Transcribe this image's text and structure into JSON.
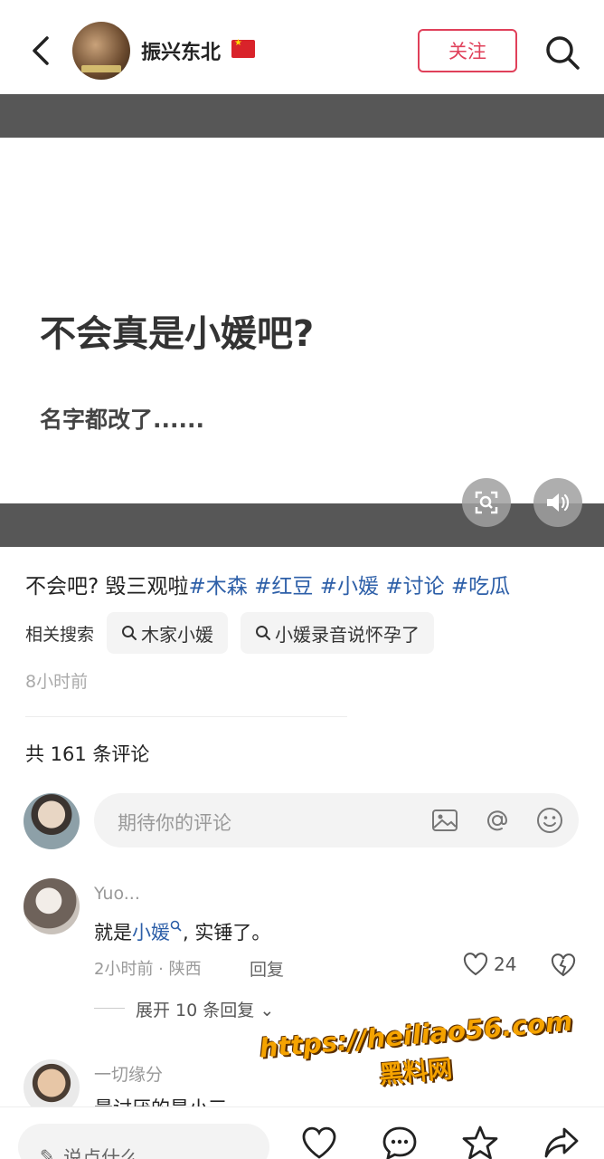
{
  "header": {
    "username": "振兴东北",
    "follow_label": "关注"
  },
  "post": {
    "title": "不会真是小媛吧?",
    "subtitle": "名字都改了......"
  },
  "caption": {
    "text": "不会吧?  毁三观啦",
    "tags": [
      "#木森",
      "#红豆",
      "#小媛",
      "#讨论",
      "#吃瓜"
    ]
  },
  "related": {
    "label": "相关搜索",
    "items": [
      "木家小媛",
      "小媛录音说怀孕了"
    ]
  },
  "time_ago": "8小时前",
  "comments": {
    "count_label": "共 161 条评论",
    "input_placeholder": "期待你的评论",
    "items": [
      {
        "user": "Yuo...",
        "text_before": "就是",
        "link": "小媛",
        "text_after": ", 实锤了。",
        "meta": "2小时前 · 陕西",
        "reply_label": "回复",
        "likes": "24",
        "expand_label": "展开 10 条回复"
      },
      {
        "user": "一切缘分",
        "text": "最讨厌的是小三"
      }
    ]
  },
  "watermark": {
    "url": "https://heiliao56.com",
    "name": "黑料网"
  },
  "bottom_bar": {
    "say_placeholder": "说点什么..."
  },
  "colors": {
    "accent": "#e0405a",
    "link": "#2d5fa8",
    "band": "#575757"
  }
}
